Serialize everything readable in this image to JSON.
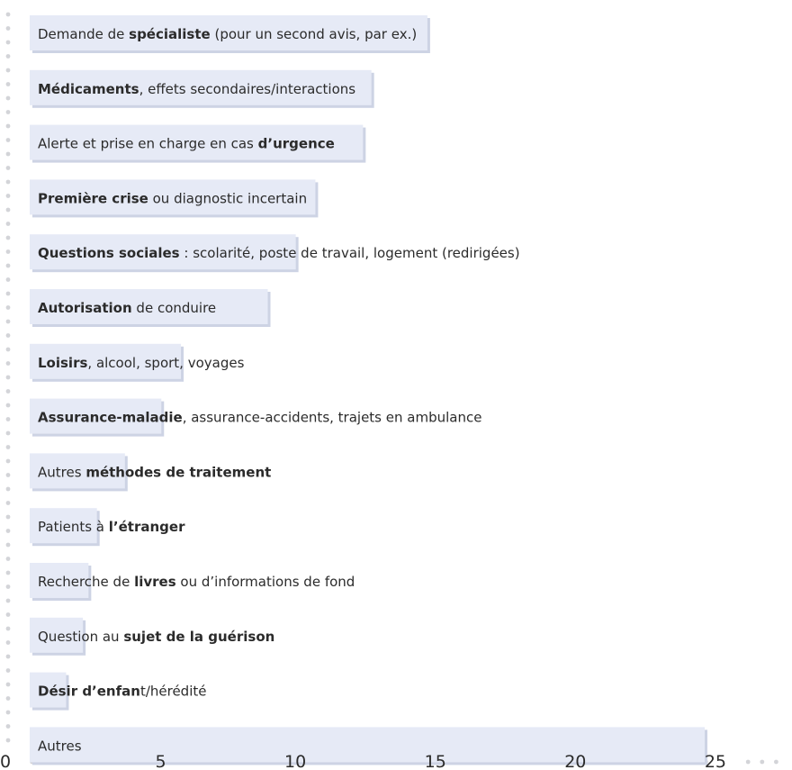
{
  "chart_data": {
    "type": "bar",
    "orientation": "horizontal",
    "xlim": [
      0,
      25
    ],
    "xticks": [
      0,
      5,
      10,
      15,
      20,
      25
    ],
    "grid": false,
    "colors": {
      "bar": "#e6eaf6",
      "shadow": "#cdd3e4",
      "dots": "#d3d4d8",
      "text": "#2b2b2b"
    },
    "categories": [
      [
        {
          "t": "Demande de ",
          "b": false
        },
        {
          "t": "spécialiste",
          "b": true
        },
        {
          "t": " (pour un second avis, par ex.)",
          "b": false
        }
      ],
      [
        {
          "t": "Médicaments",
          "b": true
        },
        {
          "t": ", effets secondaires/interactions",
          "b": false
        }
      ],
      [
        {
          "t": "Alerte et prise en charge en cas ",
          "b": false
        },
        {
          "t": "d’urgence",
          "b": true
        }
      ],
      [
        {
          "t": "Première crise",
          "b": true
        },
        {
          "t": " ou diagnostic incertain",
          "b": false
        }
      ],
      [
        {
          "t": "Questions sociales",
          "b": true
        },
        {
          "t": " : scolarité, poste de travail, logement (redirigées)",
          "b": false
        }
      ],
      [
        {
          "t": "Autorisation",
          "b": true
        },
        {
          "t": " de conduire",
          "b": false
        }
      ],
      [
        {
          "t": "Loisirs",
          "b": true
        },
        {
          "t": ", alcool, sport, voyages",
          "b": false
        }
      ],
      [
        {
          "t": "Assurance-maladie",
          "b": true
        },
        {
          "t": ", assurance-accidents, trajets en ambulance",
          "b": false
        }
      ],
      [
        {
          "t": "Autres ",
          "b": false
        },
        {
          "t": "méthodes de traitement",
          "b": true
        }
      ],
      [
        {
          "t": "Patients à ",
          "b": false
        },
        {
          "t": "l’étranger",
          "b": true
        }
      ],
      [
        {
          "t": "Recherche de ",
          "b": false
        },
        {
          "t": "livres",
          "b": true
        },
        {
          "t": " ou d’informations de fond",
          "b": false
        }
      ],
      [
        {
          "t": "Question au ",
          "b": false
        },
        {
          "t": "sujet de la guérison",
          "b": true
        }
      ],
      [
        {
          "t": "Désir d’enfan",
          "b": true
        },
        {
          "t": "t/hérédité",
          "b": false
        }
      ],
      [
        {
          "t": "Autres",
          "b": false
        }
      ]
    ],
    "values": [
      14.2,
      12.2,
      11.9,
      10.2,
      9.5,
      8.5,
      5.4,
      4.7,
      3.4,
      2.4,
      2.1,
      1.9,
      1.3,
      24.1
    ]
  }
}
